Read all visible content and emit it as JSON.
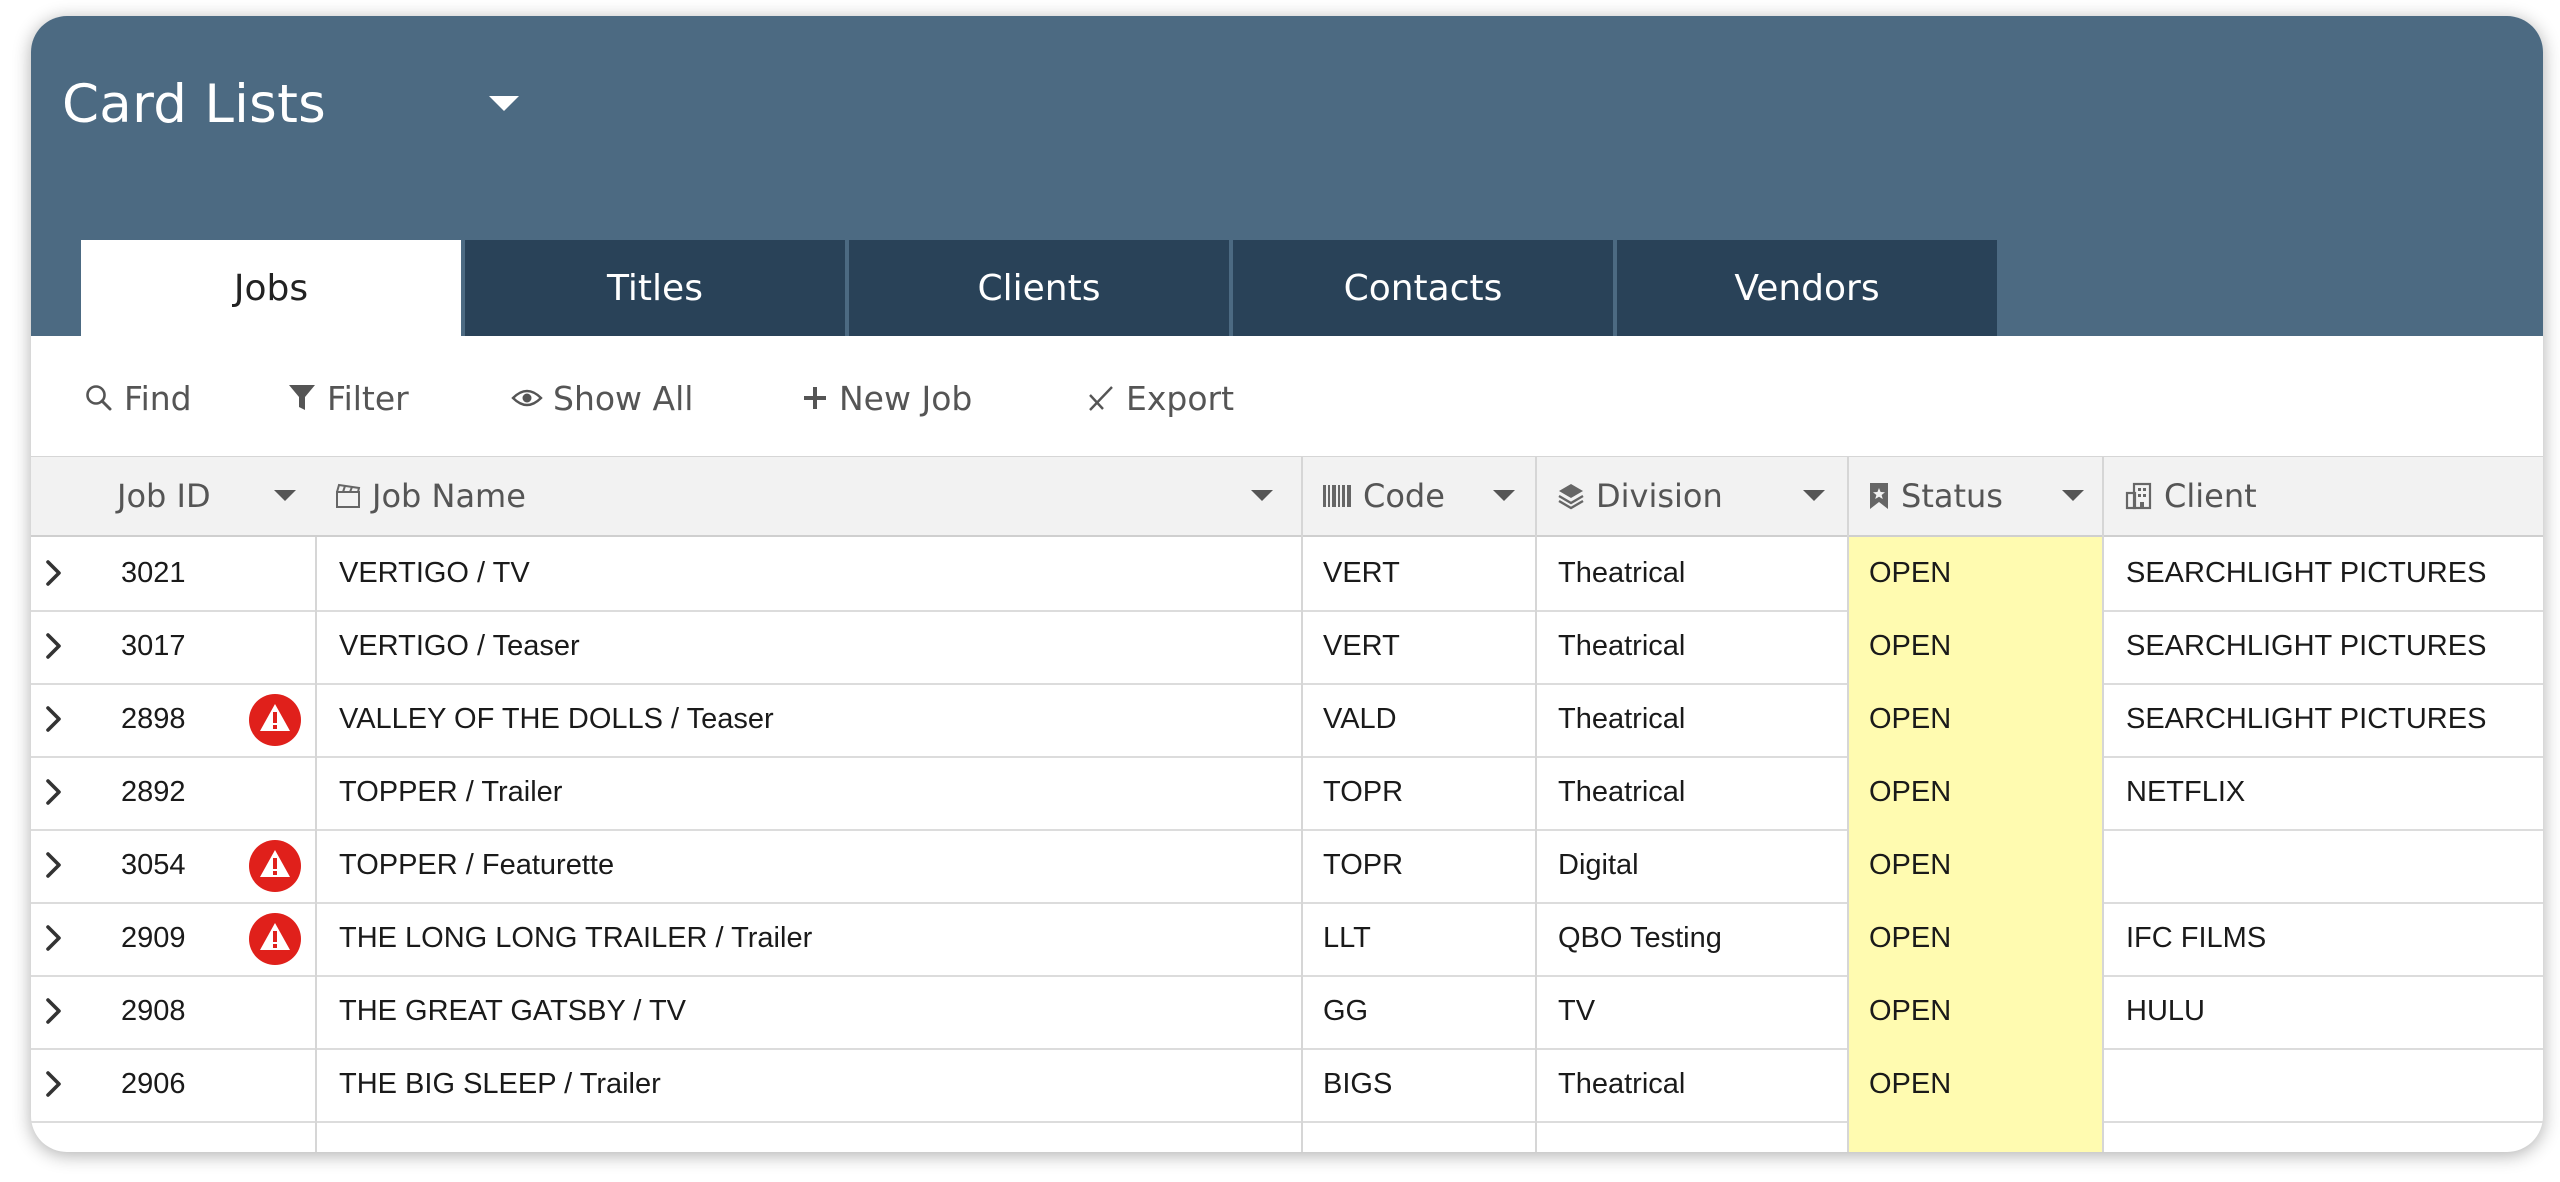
{
  "app": {
    "title": "Card Lists"
  },
  "tabs": [
    {
      "label": "Jobs",
      "active": true
    },
    {
      "label": "Titles",
      "active": false
    },
    {
      "label": "Clients",
      "active": false
    },
    {
      "label": "Contacts",
      "active": false
    },
    {
      "label": "Vendors",
      "active": false
    }
  ],
  "toolbar": {
    "find": "Find",
    "filter": "Filter",
    "show_all": "Show All",
    "new_job": "New Job",
    "export": "Export"
  },
  "columns": {
    "job_id": "Job ID",
    "job_name": "Job Name",
    "code": "Code",
    "division": "Division",
    "status": "Status",
    "client": "Client"
  },
  "colors": {
    "header": "#4c6a82",
    "tab": "#294258",
    "status_highlight": "#fffbb0",
    "warning": "#e0201b"
  },
  "rows": [
    {
      "job_id": "3021",
      "warning": false,
      "job_name": "VERTIGO / TV",
      "code": "VERT",
      "division": "Theatrical",
      "status": "OPEN",
      "client": "SEARCHLIGHT PICTURES"
    },
    {
      "job_id": "3017",
      "warning": false,
      "job_name": "VERTIGO / Teaser",
      "code": "VERT",
      "division": "Theatrical",
      "status": "OPEN",
      "client": "SEARCHLIGHT PICTURES"
    },
    {
      "job_id": "2898",
      "warning": true,
      "job_name": "VALLEY OF THE DOLLS / Teaser",
      "code": "VALD",
      "division": "Theatrical",
      "status": "OPEN",
      "client": "SEARCHLIGHT PICTURES"
    },
    {
      "job_id": "2892",
      "warning": false,
      "job_name": "TOPPER / Trailer",
      "code": "TOPR",
      "division": "Theatrical",
      "status": "OPEN",
      "client": "NETFLIX"
    },
    {
      "job_id": "3054",
      "warning": true,
      "job_name": "TOPPER / Featurette",
      "code": "TOPR",
      "division": "Digital",
      "status": "OPEN",
      "client": ""
    },
    {
      "job_id": "2909",
      "warning": true,
      "job_name": "THE LONG LONG TRAILER / Trailer",
      "code": "LLT",
      "division": "QBO Testing",
      "status": "OPEN",
      "client": "IFC FILMS"
    },
    {
      "job_id": "2908",
      "warning": false,
      "job_name": "THE GREAT GATSBY / TV",
      "code": "GG",
      "division": "TV",
      "status": "OPEN",
      "client": "HULU"
    },
    {
      "job_id": "2906",
      "warning": false,
      "job_name": "THE BIG SLEEP / Trailer",
      "code": "BIGS",
      "division": "Theatrical",
      "status": "OPEN",
      "client": ""
    }
  ]
}
